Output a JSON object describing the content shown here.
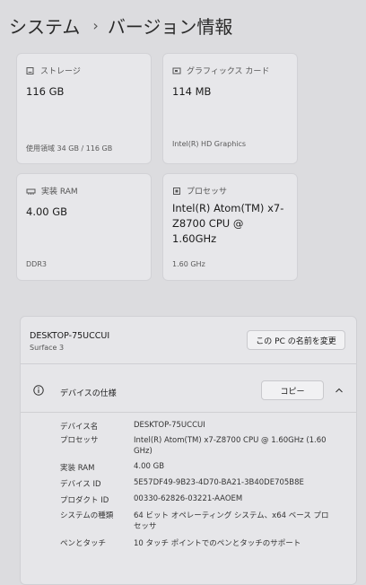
{
  "breadcrumb": {
    "parent": "システム",
    "separator": "›",
    "current": "バージョン情報"
  },
  "cards": {
    "storage": {
      "title": "ストレージ",
      "value": "116 GB",
      "sub": "使用領域 34 GB / 116 GB"
    },
    "graphics": {
      "title": "グラフィックス カード",
      "value": "114 MB",
      "sub": "Intel(R) HD Graphics"
    },
    "ram": {
      "title": "実装 RAM",
      "value": "4.00 GB",
      "sub": "DDR3"
    },
    "processor": {
      "title": "プロセッサ",
      "value": "Intel(R) Atom(TM) x7-Z8700  CPU @ 1.60GHz",
      "sub": "1.60 GHz"
    }
  },
  "device": {
    "name": "DESKTOP-75UCCUI",
    "model": "Surface 3",
    "rename_label": "この PC の名前を変更"
  },
  "specs": {
    "title": "デバイスの仕様",
    "copy_label": "コピー",
    "rows": [
      {
        "key": "デバイス名",
        "value": "DESKTOP-75UCCUI"
      },
      {
        "key": "プロセッサ",
        "value": "Intel(R) Atom(TM) x7-Z8700  CPU @ 1.60GHz (1.60 GHz)"
      },
      {
        "key": "実装 RAM",
        "value": "4.00 GB"
      },
      {
        "key": "デバイス ID",
        "value": "5E57DF49-9B23-4D70-BA21-3B40DE705B8E"
      },
      {
        "key": "プロダクト ID",
        "value": "00330-62826-03221-AAOEM"
      },
      {
        "key": "システムの種類",
        "value": "64 ビット オペレーティング システム、x64 ベース プロセッサ"
      },
      {
        "key": "ペンとタッチ",
        "value": "10 タッチ ポイントでのペンとタッチのサポート"
      }
    ]
  }
}
